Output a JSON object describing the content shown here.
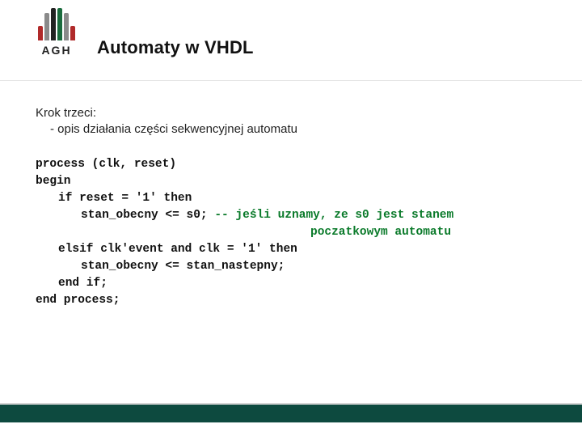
{
  "logo": {
    "text": "AGH"
  },
  "title": "Automaty w VHDL",
  "step": {
    "heading": "Krok trzeci:",
    "sub": "- opis działania części sekwencyjnej automatu"
  },
  "code": {
    "l1": "process (clk, reset)",
    "l2": "begin",
    "l3": "if reset = '1' then",
    "l4a": "stan_obecny <= s0; ",
    "l4c": "-- jeśli uznamy, ze s0 jest stanem",
    "l5c": "poczatkowym automatu",
    "l6": "elsif clk'event and clk = '1' then",
    "l7": "stan_obecny <= stan_nastepny;",
    "l8": "end if;",
    "l9": "end process;"
  }
}
